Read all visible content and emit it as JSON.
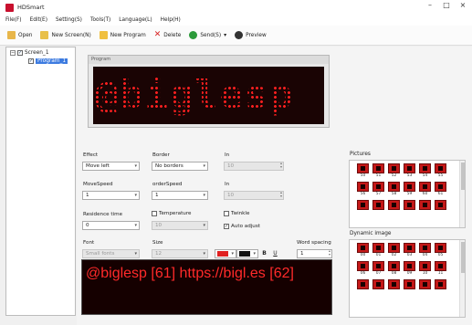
{
  "window": {
    "title": "HDSmart",
    "controls": [
      "–",
      "□",
      "×"
    ]
  },
  "menu": [
    "File(F)",
    "Edit(E)",
    "Setting(S)",
    "Tools(T)",
    "Language(L)",
    "Help(H)"
  ],
  "toolbar": {
    "open": "Open",
    "new_screen": "New Screen(N)",
    "new_program": "New Program",
    "delete": "Delete",
    "send": "Send(S)",
    "send_arrow": "▾",
    "preview": "Preview"
  },
  "tree": {
    "screen": "Screen_1",
    "program": "Program_1"
  },
  "preview": {
    "header": "Program",
    "led_text": "@biglesp [61"
  },
  "form": {
    "effect_label": "Effect",
    "effect_value": "Move left",
    "border_label": "Border",
    "border_value": "No borders",
    "in_label_1": "In",
    "in_value_1": "10",
    "movespeed_label": "MoveSpeed",
    "movespeed_value": "1",
    "borderspeed_label": "orderSpeed",
    "borderspeed_value": "1",
    "in_label_2": "In",
    "in_value_2": "10",
    "residence_label": "Residence time",
    "residence_value": "0",
    "temperature_label": "Temperature",
    "temperature_value": "10",
    "twinkle_label": "Twinkle",
    "autoadjust_label": "Auto adjust",
    "font_label": "Font",
    "font_value": "Small fonts",
    "size_label": "Size",
    "size_value": "12",
    "bold_label": "B",
    "underline_label": "U",
    "word_spacing_label": "Word spacing",
    "word_spacing_value": "1"
  },
  "editor_text": "@biglesp [61] https://bigl.es [62]",
  "pictures": {
    "title": "Pictures",
    "row1": [
      "50",
      "51",
      "52",
      "53",
      "54",
      "55"
    ],
    "row2": [
      "56",
      "57",
      "58",
      "59",
      "60",
      "61"
    ]
  },
  "dynamic_image": {
    "title": "Dynamic image",
    "row1": [
      "00",
      "01",
      "02",
      "03",
      "04",
      "05"
    ],
    "row2": [
      "06",
      "07",
      "08",
      "09",
      "10",
      "11"
    ]
  },
  "colors": {
    "text_color": "#e02020",
    "bg_color": "#111111",
    "led_red": "#ff2020"
  },
  "icons": {
    "open": "folder-open-icon",
    "new_screen": "new-screen-icon",
    "new_program": "new-program-icon",
    "delete": "delete-x-icon",
    "send": "send-icon",
    "preview": "play-icon"
  }
}
